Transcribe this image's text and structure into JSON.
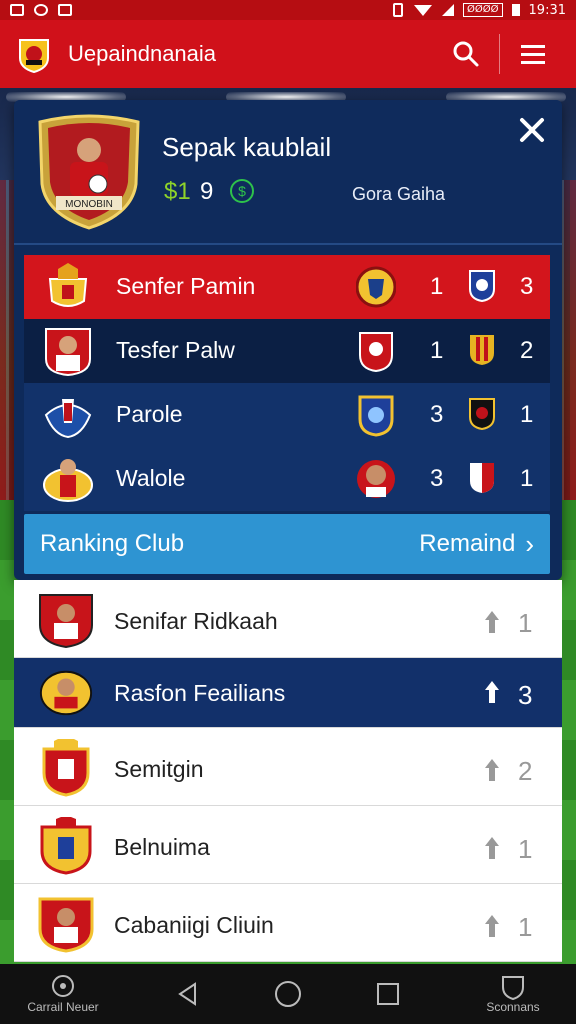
{
  "status_bar": {
    "left_icons": [
      "notification-icon",
      "app-icon",
      "image-icon"
    ],
    "signal_box": "ØØØØ",
    "time": "19:31"
  },
  "app_bar": {
    "title": "Uepaindnanaia"
  },
  "card": {
    "club_name": "Sepak kaublail",
    "stat_a": "$1",
    "stat_b": "9",
    "coin": "$",
    "subtitle": "Gora Gaiha",
    "badge_text": "MONOBIN"
  },
  "matches": [
    {
      "name": "Senfer Pamin",
      "score1": "1",
      "score2": "3"
    },
    {
      "name": "Tesfer Palw",
      "score1": "1",
      "score2": "2"
    },
    {
      "name": "Parole",
      "score1": "3",
      "score2": "1"
    },
    {
      "name": "Walole",
      "score1": "3",
      "score2": "1"
    }
  ],
  "ranking": {
    "title": "Ranking Club",
    "link": "Remaind"
  },
  "rank_list": [
    {
      "name": "Senifar Ridkaah",
      "rank": "1"
    },
    {
      "name": "Rasfon Feailians",
      "rank": "3"
    },
    {
      "name": "Semitgin",
      "rank": "2"
    },
    {
      "name": "Belnuima",
      "rank": "1"
    },
    {
      "name": "Cabaniigi Cliuin",
      "rank": "1"
    }
  ],
  "nav": {
    "left_label": "Carrail Neuer",
    "right_label": "Sconnans"
  },
  "colors": {
    "primary_red": "#d0111a",
    "navy": "#0e2a5a",
    "accent_blue": "#2e94d2"
  }
}
